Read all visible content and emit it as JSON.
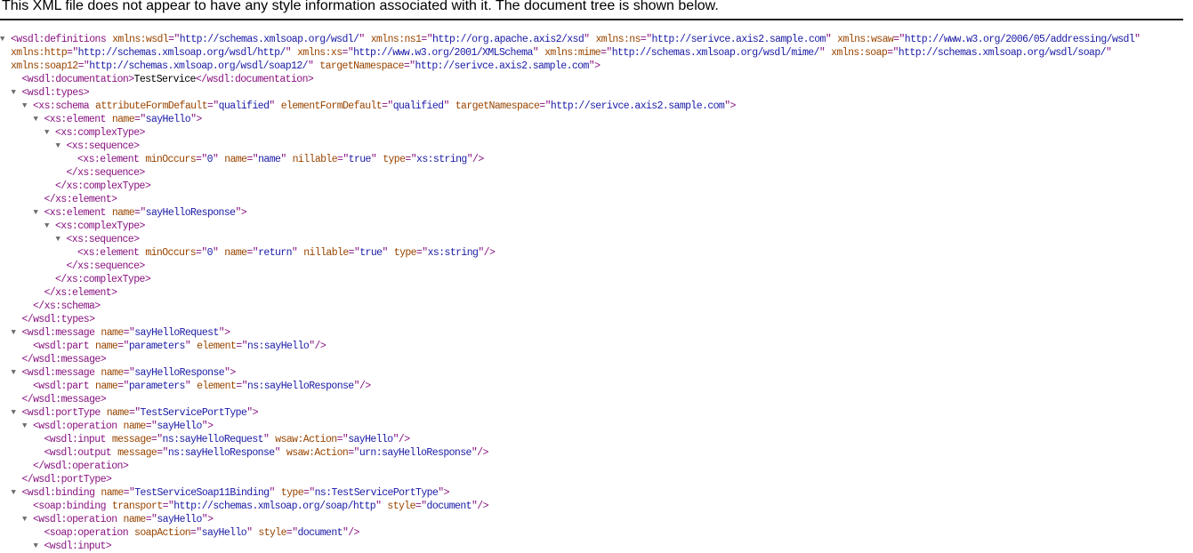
{
  "banner": "This XML file does not appear to have any style information associated with it. The document tree is shown below.",
  "lines": [
    {
      "d": 0,
      "t": true,
      "p": [
        [
          "t",
          "<wsdl:definitions"
        ],
        [
          "a",
          "xmlns:wsdl"
        ],
        [
          "e",
          "=\""
        ],
        [
          "v",
          "http://schemas.xmlsoap.org/wsdl/"
        ],
        [
          "e",
          "\""
        ],
        [
          "a",
          "xmlns:ns1"
        ],
        [
          "e",
          "=\""
        ],
        [
          "v",
          "http://org.apache.axis2/xsd"
        ],
        [
          "e",
          "\""
        ],
        [
          "a",
          "xmlns:ns"
        ],
        [
          "e",
          "=\""
        ],
        [
          "v",
          "http://serivce.axis2.sample.com"
        ],
        [
          "e",
          "\""
        ],
        [
          "a",
          "xmlns:wsaw"
        ],
        [
          "e",
          "=\""
        ],
        [
          "v",
          "http://www.w3.org/2006/05/addressing/wsdl"
        ],
        [
          "e",
          "\""
        ]
      ]
    },
    {
      "d": 0,
      "t": false,
      "p": [
        [
          "a",
          "xmlns:http"
        ],
        [
          "e",
          "=\""
        ],
        [
          "v",
          "http://schemas.xmlsoap.org/wsdl/http/"
        ],
        [
          "e",
          "\""
        ],
        [
          "a",
          "xmlns:xs"
        ],
        [
          "e",
          "=\""
        ],
        [
          "v",
          "http://www.w3.org/2001/XMLSchema"
        ],
        [
          "e",
          "\""
        ],
        [
          "a",
          "xmlns:mime"
        ],
        [
          "e",
          "=\""
        ],
        [
          "v",
          "http://schemas.xmlsoap.org/wsdl/mime/"
        ],
        [
          "e",
          "\""
        ],
        [
          "a",
          "xmlns:soap"
        ],
        [
          "e",
          "=\""
        ],
        [
          "v",
          "http://schemas.xmlsoap.org/wsdl/soap/"
        ],
        [
          "e",
          "\""
        ]
      ]
    },
    {
      "d": 0,
      "t": false,
      "p": [
        [
          "a",
          "xmlns:soap12"
        ],
        [
          "e",
          "=\""
        ],
        [
          "v",
          "http://schemas.xmlsoap.org/wsdl/soap12/"
        ],
        [
          "e",
          "\""
        ],
        [
          "a",
          "targetNamespace"
        ],
        [
          "e",
          "=\""
        ],
        [
          "v",
          "http://serivce.axis2.sample.com"
        ],
        [
          "e",
          "\""
        ],
        [
          "t",
          ">"
        ]
      ]
    },
    {
      "d": 1,
      "t": false,
      "p": [
        [
          "t",
          "<wsdl:documentation>"
        ],
        [
          "x",
          "TestService"
        ],
        [
          "t",
          "</wsdl:documentation>"
        ]
      ]
    },
    {
      "d": 1,
      "t": true,
      "p": [
        [
          "t",
          "<wsdl:types>"
        ]
      ]
    },
    {
      "d": 2,
      "t": true,
      "p": [
        [
          "t",
          "<xs:schema"
        ],
        [
          "a",
          "attributeFormDefault"
        ],
        [
          "e",
          "=\""
        ],
        [
          "v",
          "qualified"
        ],
        [
          "e",
          "\""
        ],
        [
          "a",
          "elementFormDefault"
        ],
        [
          "e",
          "=\""
        ],
        [
          "v",
          "qualified"
        ],
        [
          "e",
          "\""
        ],
        [
          "a",
          "targetNamespace"
        ],
        [
          "e",
          "=\""
        ],
        [
          "v",
          "http://serivce.axis2.sample.com"
        ],
        [
          "e",
          "\""
        ],
        [
          "t",
          ">"
        ]
      ]
    },
    {
      "d": 3,
      "t": true,
      "p": [
        [
          "t",
          "<xs:element"
        ],
        [
          "a",
          "name"
        ],
        [
          "e",
          "=\""
        ],
        [
          "v",
          "sayHello"
        ],
        [
          "e",
          "\""
        ],
        [
          "t",
          ">"
        ]
      ]
    },
    {
      "d": 4,
      "t": true,
      "p": [
        [
          "t",
          "<xs:complexType>"
        ]
      ]
    },
    {
      "d": 5,
      "t": true,
      "p": [
        [
          "t",
          "<xs:sequence>"
        ]
      ]
    },
    {
      "d": 6,
      "t": false,
      "p": [
        [
          "t",
          "<xs:element"
        ],
        [
          "a",
          "minOccurs"
        ],
        [
          "e",
          "=\""
        ],
        [
          "v",
          "0"
        ],
        [
          "e",
          "\""
        ],
        [
          "a",
          "name"
        ],
        [
          "e",
          "=\""
        ],
        [
          "v",
          "name"
        ],
        [
          "e",
          "\""
        ],
        [
          "a",
          "nillable"
        ],
        [
          "e",
          "=\""
        ],
        [
          "v",
          "true"
        ],
        [
          "e",
          "\""
        ],
        [
          "a",
          "type"
        ],
        [
          "e",
          "=\""
        ],
        [
          "v",
          "xs:string"
        ],
        [
          "e",
          "\""
        ],
        [
          "t",
          "/>"
        ]
      ]
    },
    {
      "d": 5,
      "t": false,
      "p": [
        [
          "t",
          "</xs:sequence>"
        ]
      ]
    },
    {
      "d": 4,
      "t": false,
      "p": [
        [
          "t",
          "</xs:complexType>"
        ]
      ]
    },
    {
      "d": 3,
      "t": false,
      "p": [
        [
          "t",
          "</xs:element>"
        ]
      ]
    },
    {
      "d": 3,
      "t": true,
      "p": [
        [
          "t",
          "<xs:element"
        ],
        [
          "a",
          "name"
        ],
        [
          "e",
          "=\""
        ],
        [
          "v",
          "sayHelloResponse"
        ],
        [
          "e",
          "\""
        ],
        [
          "t",
          ">"
        ]
      ]
    },
    {
      "d": 4,
      "t": true,
      "p": [
        [
          "t",
          "<xs:complexType>"
        ]
      ]
    },
    {
      "d": 5,
      "t": true,
      "p": [
        [
          "t",
          "<xs:sequence>"
        ]
      ]
    },
    {
      "d": 6,
      "t": false,
      "p": [
        [
          "t",
          "<xs:element"
        ],
        [
          "a",
          "minOccurs"
        ],
        [
          "e",
          "=\""
        ],
        [
          "v",
          "0"
        ],
        [
          "e",
          "\""
        ],
        [
          "a",
          "name"
        ],
        [
          "e",
          "=\""
        ],
        [
          "v",
          "return"
        ],
        [
          "e",
          "\""
        ],
        [
          "a",
          "nillable"
        ],
        [
          "e",
          "=\""
        ],
        [
          "v",
          "true"
        ],
        [
          "e",
          "\""
        ],
        [
          "a",
          "type"
        ],
        [
          "e",
          "=\""
        ],
        [
          "v",
          "xs:string"
        ],
        [
          "e",
          "\""
        ],
        [
          "t",
          "/>"
        ]
      ]
    },
    {
      "d": 5,
      "t": false,
      "p": [
        [
          "t",
          "</xs:sequence>"
        ]
      ]
    },
    {
      "d": 4,
      "t": false,
      "p": [
        [
          "t",
          "</xs:complexType>"
        ]
      ]
    },
    {
      "d": 3,
      "t": false,
      "p": [
        [
          "t",
          "</xs:element>"
        ]
      ]
    },
    {
      "d": 2,
      "t": false,
      "p": [
        [
          "t",
          "</xs:schema>"
        ]
      ]
    },
    {
      "d": 1,
      "t": false,
      "p": [
        [
          "t",
          "</wsdl:types>"
        ]
      ]
    },
    {
      "d": 1,
      "t": true,
      "p": [
        [
          "t",
          "<wsdl:message"
        ],
        [
          "a",
          "name"
        ],
        [
          "e",
          "=\""
        ],
        [
          "v",
          "sayHelloRequest"
        ],
        [
          "e",
          "\""
        ],
        [
          "t",
          ">"
        ]
      ]
    },
    {
      "d": 2,
      "t": false,
      "p": [
        [
          "t",
          "<wsdl:part"
        ],
        [
          "a",
          "name"
        ],
        [
          "e",
          "=\""
        ],
        [
          "v",
          "parameters"
        ],
        [
          "e",
          "\""
        ],
        [
          "a",
          "element"
        ],
        [
          "e",
          "=\""
        ],
        [
          "v",
          "ns:sayHello"
        ],
        [
          "e",
          "\""
        ],
        [
          "t",
          "/>"
        ]
      ]
    },
    {
      "d": 1,
      "t": false,
      "p": [
        [
          "t",
          "</wsdl:message>"
        ]
      ]
    },
    {
      "d": 1,
      "t": true,
      "p": [
        [
          "t",
          "<wsdl:message"
        ],
        [
          "a",
          "name"
        ],
        [
          "e",
          "=\""
        ],
        [
          "v",
          "sayHelloResponse"
        ],
        [
          "e",
          "\""
        ],
        [
          "t",
          ">"
        ]
      ]
    },
    {
      "d": 2,
      "t": false,
      "p": [
        [
          "t",
          "<wsdl:part"
        ],
        [
          "a",
          "name"
        ],
        [
          "e",
          "=\""
        ],
        [
          "v",
          "parameters"
        ],
        [
          "e",
          "\""
        ],
        [
          "a",
          "element"
        ],
        [
          "e",
          "=\""
        ],
        [
          "v",
          "ns:sayHelloResponse"
        ],
        [
          "e",
          "\""
        ],
        [
          "t",
          "/>"
        ]
      ]
    },
    {
      "d": 1,
      "t": false,
      "p": [
        [
          "t",
          "</wsdl:message>"
        ]
      ]
    },
    {
      "d": 1,
      "t": true,
      "p": [
        [
          "t",
          "<wsdl:portType"
        ],
        [
          "a",
          "name"
        ],
        [
          "e",
          "=\""
        ],
        [
          "v",
          "TestServicePortType"
        ],
        [
          "e",
          "\""
        ],
        [
          "t",
          ">"
        ]
      ]
    },
    {
      "d": 2,
      "t": true,
      "p": [
        [
          "t",
          "<wsdl:operation"
        ],
        [
          "a",
          "name"
        ],
        [
          "e",
          "=\""
        ],
        [
          "v",
          "sayHello"
        ],
        [
          "e",
          "\""
        ],
        [
          "t",
          ">"
        ]
      ]
    },
    {
      "d": 3,
      "t": false,
      "p": [
        [
          "t",
          "<wsdl:input"
        ],
        [
          "a",
          "message"
        ],
        [
          "e",
          "=\""
        ],
        [
          "v",
          "ns:sayHelloRequest"
        ],
        [
          "e",
          "\""
        ],
        [
          "a",
          "wsaw:Action"
        ],
        [
          "e",
          "=\""
        ],
        [
          "v",
          "sayHello"
        ],
        [
          "e",
          "\""
        ],
        [
          "t",
          "/>"
        ]
      ]
    },
    {
      "d": 3,
      "t": false,
      "p": [
        [
          "t",
          "<wsdl:output"
        ],
        [
          "a",
          "message"
        ],
        [
          "e",
          "=\""
        ],
        [
          "v",
          "ns:sayHelloResponse"
        ],
        [
          "e",
          "\""
        ],
        [
          "a",
          "wsaw:Action"
        ],
        [
          "e",
          "=\""
        ],
        [
          "v",
          "urn:sayHelloResponse"
        ],
        [
          "e",
          "\""
        ],
        [
          "t",
          "/>"
        ]
      ]
    },
    {
      "d": 2,
      "t": false,
      "p": [
        [
          "t",
          "</wsdl:operation>"
        ]
      ]
    },
    {
      "d": 1,
      "t": false,
      "p": [
        [
          "t",
          "</wsdl:portType>"
        ]
      ]
    },
    {
      "d": 1,
      "t": true,
      "p": [
        [
          "t",
          "<wsdl:binding"
        ],
        [
          "a",
          "name"
        ],
        [
          "e",
          "=\""
        ],
        [
          "v",
          "TestServiceSoap11Binding"
        ],
        [
          "e",
          "\""
        ],
        [
          "a",
          "type"
        ],
        [
          "e",
          "=\""
        ],
        [
          "v",
          "ns:TestServicePortType"
        ],
        [
          "e",
          "\""
        ],
        [
          "t",
          ">"
        ]
      ]
    },
    {
      "d": 2,
      "t": false,
      "p": [
        [
          "t",
          "<soap:binding"
        ],
        [
          "a",
          "transport"
        ],
        [
          "e",
          "=\""
        ],
        [
          "v",
          "http://schemas.xmlsoap.org/soap/http"
        ],
        [
          "e",
          "\""
        ],
        [
          "a",
          "style"
        ],
        [
          "e",
          "=\""
        ],
        [
          "v",
          "document"
        ],
        [
          "e",
          "\""
        ],
        [
          "t",
          "/>"
        ]
      ]
    },
    {
      "d": 2,
      "t": true,
      "p": [
        [
          "t",
          "<wsdl:operation"
        ],
        [
          "a",
          "name"
        ],
        [
          "e",
          "=\""
        ],
        [
          "v",
          "sayHello"
        ],
        [
          "e",
          "\""
        ],
        [
          "t",
          ">"
        ]
      ]
    },
    {
      "d": 3,
      "t": false,
      "p": [
        [
          "t",
          "<soap:operation"
        ],
        [
          "a",
          "soapAction"
        ],
        [
          "e",
          "=\""
        ],
        [
          "v",
          "sayHello"
        ],
        [
          "e",
          "\""
        ],
        [
          "a",
          "style"
        ],
        [
          "e",
          "=\""
        ],
        [
          "v",
          "document"
        ],
        [
          "e",
          "\""
        ],
        [
          "t",
          "/>"
        ]
      ]
    },
    {
      "d": 3,
      "t": true,
      "p": [
        [
          "t",
          "<wsdl:input>"
        ]
      ]
    }
  ]
}
